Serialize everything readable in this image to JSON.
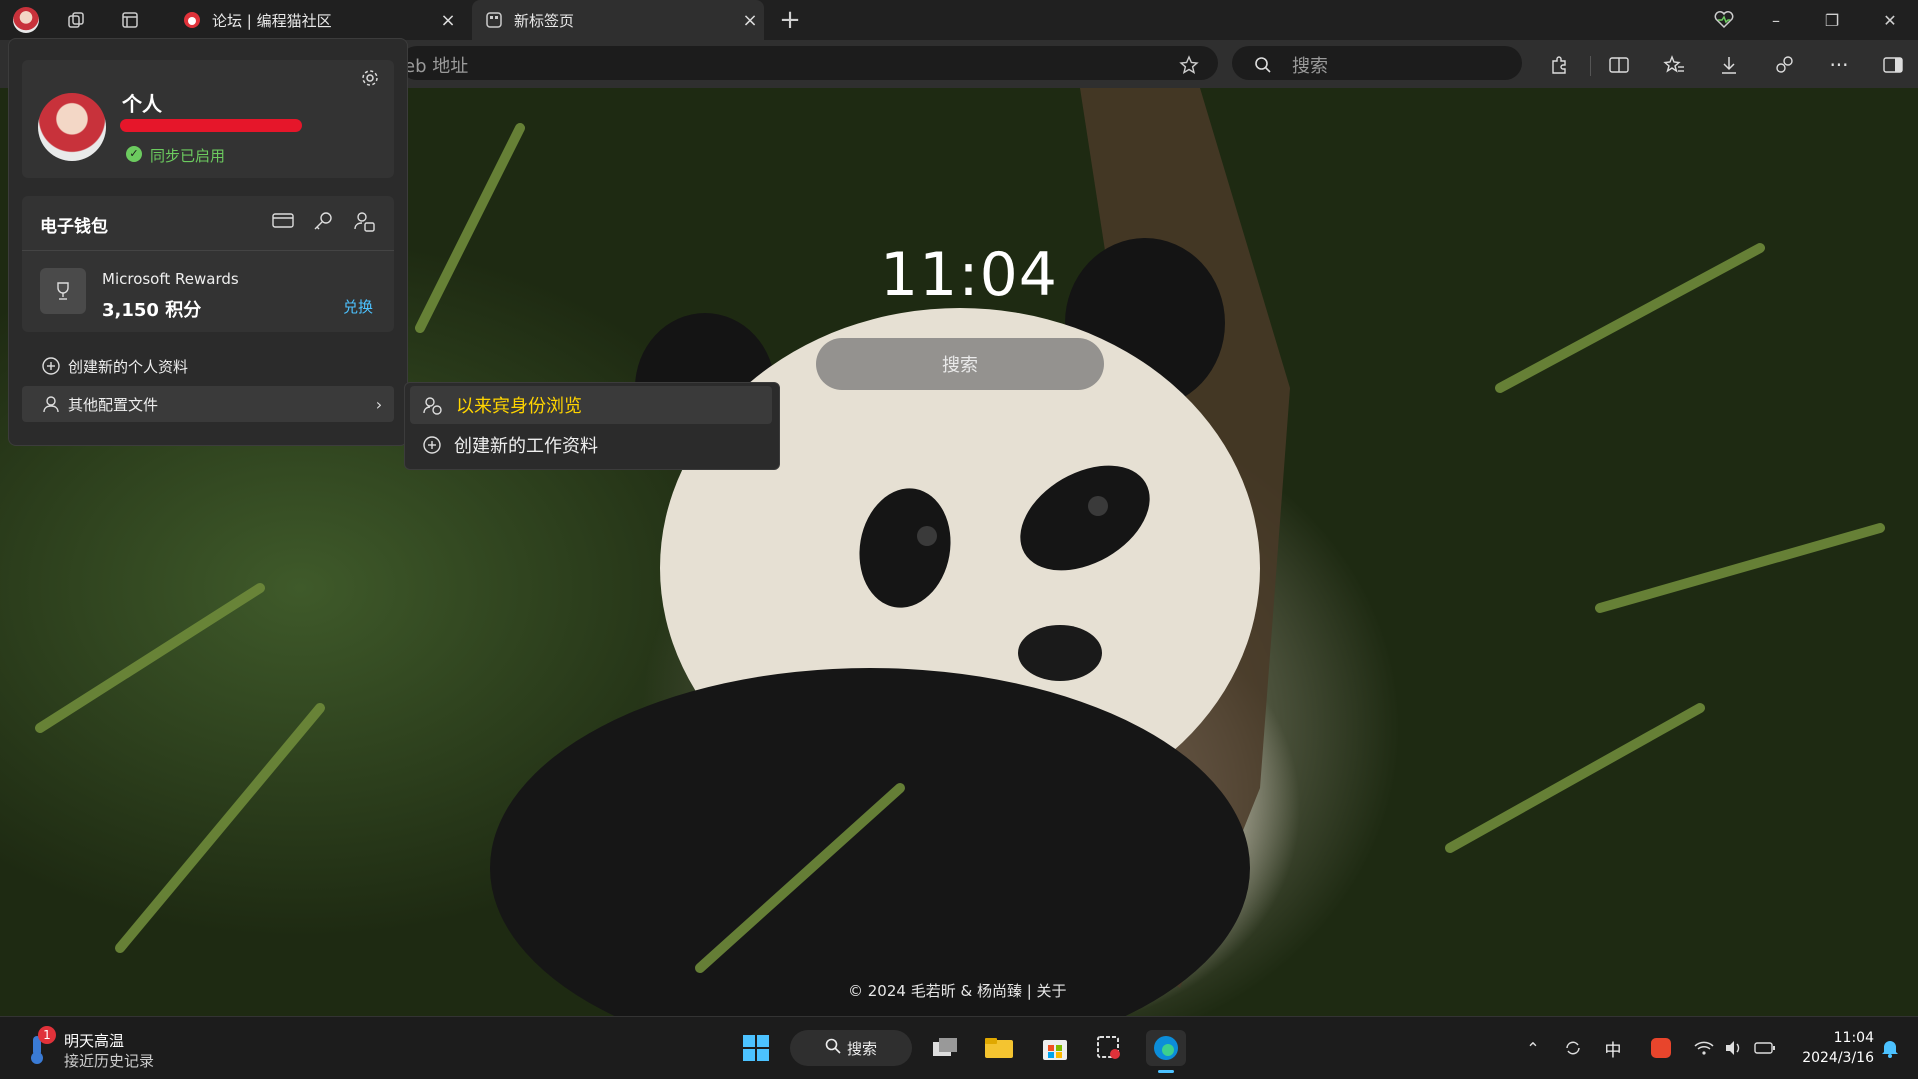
{
  "tabs": [
    {
      "title": "论坛 | 编程猫社区",
      "active": false,
      "close": "×"
    },
    {
      "title": "新标签页",
      "active": true,
      "close": "×"
    }
  ],
  "new_tab": "+",
  "window_controls": {
    "minimize": "–",
    "restore": "❐",
    "close": "✕"
  },
  "address": {
    "placeholder_tail": "eb 地址"
  },
  "bing_search": {
    "placeholder": "搜索"
  },
  "profile": {
    "name": "个人",
    "sync_status": "同步已启用",
    "sync_color": "#6ccb5f"
  },
  "wallet": {
    "title": "电子钱包",
    "rewards_title": "Microsoft Rewards",
    "rewards_points": "3,150 积分",
    "redeem": "兑换",
    "redeem_color": "#4cc2ff"
  },
  "menu": {
    "create_profile": "创建新的个人资料",
    "other_profiles": "其他配置文件"
  },
  "submenu": {
    "guest": "以来宾身份浏览",
    "work": "创建新的工作资料",
    "guest_color": "#ffd400"
  },
  "newtab_page": {
    "clock": "11:04",
    "search": "搜索",
    "credit": "© 2024 毛若昕 & 杨尚臻  |  关于"
  },
  "taskbar": {
    "weather_title": "明天高温",
    "weather_sub": "接近历史记录",
    "weather_badge": "1",
    "search": "搜索",
    "ime": "中",
    "time": "11:04",
    "date": "2024/3/16"
  },
  "icons": [
    "profile-avatar-icon",
    "workspaces-icon",
    "tab-actions-icon",
    "settings-gear-icon",
    "card-icon",
    "key-icon",
    "person-badge-icon",
    "trophy-icon",
    "plus-circle-icon",
    "person-icon",
    "chevron-right-icon",
    "guest-icon",
    "star-icon",
    "search-icon",
    "extensions-icon",
    "split-screen-icon",
    "favorites-icon",
    "download-icon",
    "share-icon",
    "more-icon",
    "sidebar-icon",
    "health-icon",
    "windows-start-icon"
  ]
}
